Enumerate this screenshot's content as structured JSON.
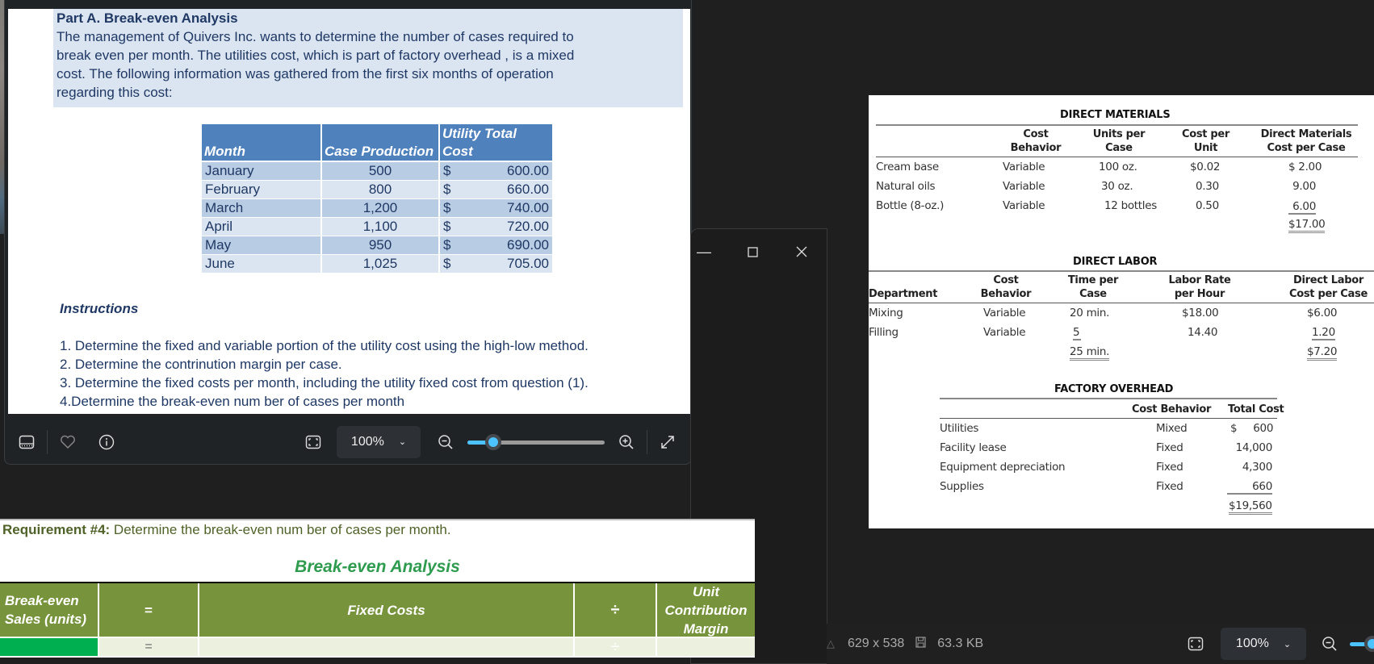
{
  "worksheet_top": {
    "intro_title": "Part A. Break-even Analysis",
    "intro_lines": [
      "The management of Quivers Inc. wants to determine the number of cases required to",
      "break even per month. The utilities cost, which is part of factory overhead , is a mixed",
      "cost. The following information was gathered from the first six months of operation",
      "regarding this cost:"
    ],
    "table": {
      "headers": [
        "Month",
        "Case Production",
        "Utility Total Cost"
      ],
      "rows": [
        {
          "month": "January",
          "production": "500",
          "currency": "$",
          "cost": "600.00"
        },
        {
          "month": "February",
          "production": "800",
          "currency": "$",
          "cost": "660.00"
        },
        {
          "month": "March",
          "production": "1,200",
          "currency": "$",
          "cost": "740.00"
        },
        {
          "month": "April",
          "production": "1,100",
          "currency": "$",
          "cost": "720.00"
        },
        {
          "month": "May",
          "production": "950",
          "currency": "$",
          "cost": "690.00"
        },
        {
          "month": "June",
          "production": "1,025",
          "currency": "$",
          "cost": "705.00"
        }
      ]
    },
    "instructions_title": "Instructions",
    "instructions": [
      "1. Determine the fixed and variable portion of the utility cost using the high-low method.",
      "2. Determine the contrinution margin per case.",
      "3. Determine the fixed costs per month, including the utility fixed cost from question (1).",
      "4.Determine the break-even num ber of cases per month"
    ]
  },
  "viewer1_toolbar": {
    "zoom_level": "100%",
    "zoom_slider_fraction": 0.15,
    "icons": [
      "filmstrip-icon",
      "heart-icon",
      "info-icon",
      "fit-icon",
      "zoom-out-icon",
      "zoom-in-icon",
      "expand-icon"
    ]
  },
  "window_controls": {
    "minimize": "—",
    "maximize": "☐",
    "close": "✕"
  },
  "right_panel": {
    "direct_materials": {
      "title": "DIRECT MATERIALS",
      "headers": [
        "",
        "Cost Behavior",
        "Units per Case",
        "Cost per Unit",
        "Direct Materials Cost per Case"
      ],
      "rows": [
        [
          "Cream base",
          "Variable",
          "100 oz.",
          "$0.02",
          "$  2.00"
        ],
        [
          "Natural oils",
          "Variable",
          "30 oz.",
          "0.30",
          "9.00"
        ],
        [
          "Bottle (8-oz.)",
          "Variable",
          "12 bottles",
          "0.50",
          "6.00"
        ]
      ],
      "total": "$17.00"
    },
    "direct_labor": {
      "title": "DIRECT LABOR",
      "headers": [
        "Department",
        "Cost Behavior",
        "Time per Case",
        "Labor Rate per Hour",
        "Direct Labor Cost per Case"
      ],
      "rows": [
        [
          "Mixing",
          "Variable",
          "20 min.",
          "$18.00",
          "$6.00"
        ],
        [
          "Filling",
          "Variable",
          "5",
          "14.40",
          "1.20"
        ]
      ],
      "total_time": "25 min.",
      "total_cost": "$7.20"
    },
    "factory_overhead": {
      "title": "FACTORY OVERHEAD",
      "headers": [
        "",
        "Cost Behavior",
        "Total Cost"
      ],
      "rows": [
        [
          "Utilities",
          "Mixed",
          "$     600"
        ],
        [
          "Facility lease",
          "Fixed",
          "14,000"
        ],
        [
          "Equipment depreciation",
          "Fixed",
          "4,300"
        ],
        [
          "Supplies",
          "Fixed",
          "660"
        ]
      ],
      "total": "$19,560"
    }
  },
  "viewer2_toolbar": {
    "dimensions": "629 x 538",
    "file_size": "63.3 KB",
    "zoom_level": "100%"
  },
  "worksheet_bottom": {
    "requirement_label": "Requirement #4:",
    "requirement_text": " Determine the break-even num ber of cases per month.",
    "title": "Break-even Analysis",
    "headers": [
      "Break-even Sales (units)",
      "=",
      "Fixed Costs",
      "÷",
      "Unit Contribution Margin"
    ],
    "row": [
      "",
      "=",
      "",
      "÷",
      ""
    ],
    "colors": {
      "header_green": "#77933c",
      "answer_green": "#00b050",
      "row_fill": "#ebf1de"
    }
  }
}
